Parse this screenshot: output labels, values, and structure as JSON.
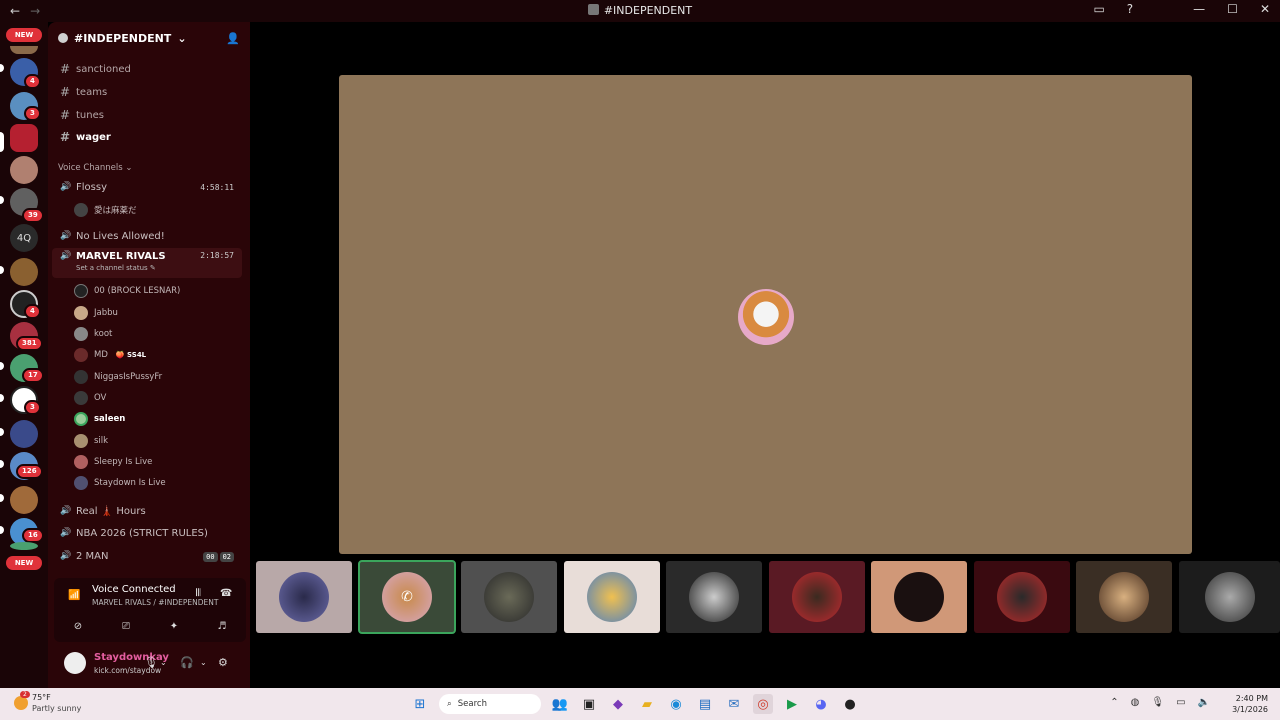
{
  "window": {
    "title": "#INDEPENDENT",
    "back_glyph": "←",
    "forward_glyph": "→",
    "controls": [
      "—",
      "☐",
      "✕"
    ]
  },
  "rail": {
    "new_label": "NEW",
    "servers": [
      {
        "badge": "4"
      },
      {
        "badge": "3"
      },
      {
        "badge": ""
      },
      {
        "badge": ""
      },
      {
        "badge": "39"
      },
      {
        "label": "4Q"
      },
      {
        "badge": ""
      },
      {
        "badge": "4"
      },
      {
        "badge": "381"
      },
      {
        "badge": "17"
      },
      {
        "badge": "3"
      },
      {
        "badge": ""
      },
      {
        "badge": "126"
      },
      {
        "badge": ""
      },
      {
        "badge": "16"
      }
    ]
  },
  "server": {
    "name": "#INDEPENDENT",
    "text_channels": [
      "sanctioned",
      "teams",
      "tunes",
      "wager"
    ],
    "voice_section_label": "Voice Channels",
    "voice_channels": [
      {
        "name": "Flossy",
        "time": "4:58:11",
        "members": [
          "愛は麻薬だ"
        ]
      },
      {
        "name": "No Lives Allowed!"
      },
      {
        "name": "MARVEL RIVALS",
        "time": "2:18:57",
        "status": "Set a channel status",
        "members": [
          "00 (BROCK LESNAR)",
          "Jabbu",
          "koot",
          "MD",
          "NiggasIsPussyFr",
          "OV",
          "saleen",
          "silk",
          "Sleepy Is Live",
          "Staydown Is Live"
        ],
        "md_tag": "SS4L"
      },
      {
        "name": "Real",
        "name_suffix": "Hours"
      },
      {
        "name": "NBA 2026 (STRICT RULES)"
      },
      {
        "name": "2 MAN",
        "pills": [
          "00",
          "02"
        ]
      }
    ]
  },
  "voice_panel": {
    "title": "Voice Connected",
    "subtitle": "MARVEL RIVALS / #INDEPENDENT"
  },
  "user_panel": {
    "username": "Staydownkay",
    "status": "kick.com/staydow"
  },
  "taskbar": {
    "temperature": "75°F",
    "weather": "Partly sunny",
    "weather_badge": "2",
    "search_placeholder": "Search",
    "time": "2:40 PM",
    "date": "3/1/2026"
  },
  "colors": {
    "accent_red": "#e0323a",
    "speaking_green": "#3ba55c",
    "stage_bg": "#8e7558",
    "sidebar_bg": "#2a0508",
    "username": "#e45ea0"
  }
}
